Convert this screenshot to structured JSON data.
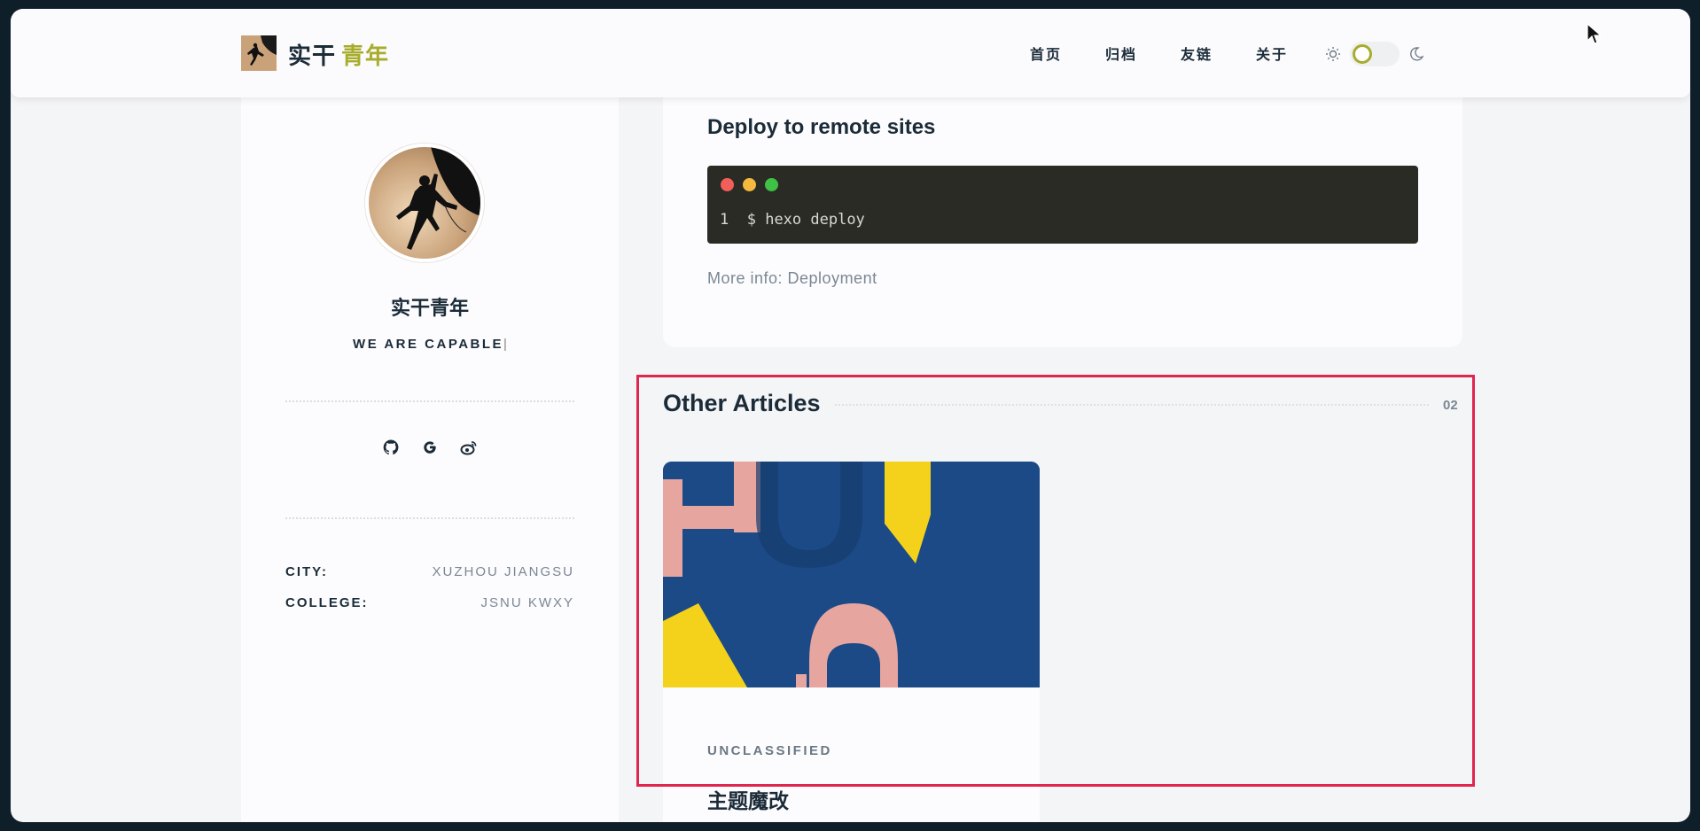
{
  "header": {
    "brand_main": "实干",
    "brand_accent": "青年",
    "nav": [
      "首页",
      "归档",
      "友链",
      "关于"
    ],
    "theme_icons": [
      "sun-icon",
      "moon-icon"
    ]
  },
  "sidebar": {
    "name": "实干青年",
    "motto": "WE ARE CAPABLE",
    "caret": "|",
    "social_icons": [
      "github-icon",
      "google-icon",
      "weibo-icon"
    ],
    "info": [
      {
        "key": "CITY:",
        "value": "XUZHOU JIANGSU"
      },
      {
        "key": "COLLEGE:",
        "value": "JSNU KWXY"
      }
    ]
  },
  "post": {
    "section_title": "Deploy to remote sites",
    "code_line_number": "1",
    "code": "$ hexo deploy",
    "more_info": "More info: Deployment"
  },
  "other": {
    "title": "Other Articles",
    "count": "02",
    "article": {
      "category": "UNCLASSIFIED",
      "title": "主题魔改"
    }
  },
  "colors": {
    "accent": "#a7ac2c",
    "text": "#1b2b38",
    "highlight": "#e0264f",
    "code_bg": "#2b2b26"
  }
}
